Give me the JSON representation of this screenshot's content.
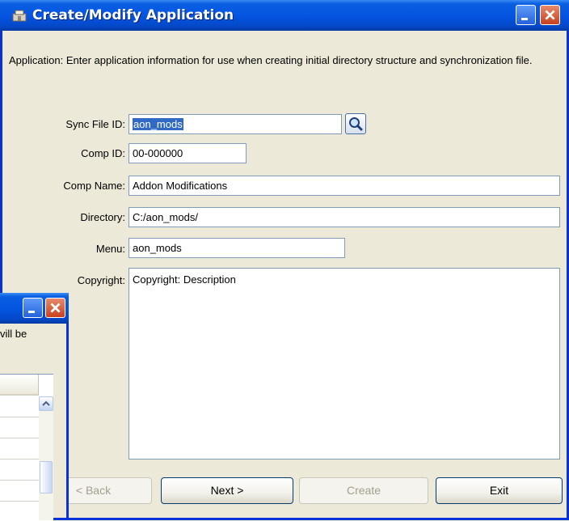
{
  "main_window": {
    "title": "Create/Modify Application",
    "description": "Application: Enter application information for use when creating initial directory structure and synchronization file.",
    "fields": {
      "sync_file_id": {
        "label": "Sync File ID:",
        "value": "aon_mods"
      },
      "comp_id": {
        "label": "Comp ID:",
        "value": "00-000000"
      },
      "comp_name": {
        "label": "Comp Name:",
        "value": "Addon Modifications"
      },
      "directory": {
        "label": "Directory:",
        "value": "C:/aon_mods/"
      },
      "menu": {
        "label": "Menu:",
        "value": "aon_mods"
      },
      "copyright": {
        "label": "Copyright:",
        "value": "Copyright: Description"
      }
    },
    "buttons": {
      "back": "< Back",
      "next": "Next >",
      "create": "Create",
      "exit": "Exit"
    }
  },
  "background_window": {
    "partial_text": "vill be"
  },
  "colors": {
    "titlebar": "#0555e3",
    "close_button": "#c8411e",
    "selection": "#316ac5",
    "dialog_bg": "#ece9d8"
  },
  "icons": [
    "app-icon",
    "search-icon",
    "minimize-icon",
    "close-icon",
    "scroll-up-icon"
  ]
}
